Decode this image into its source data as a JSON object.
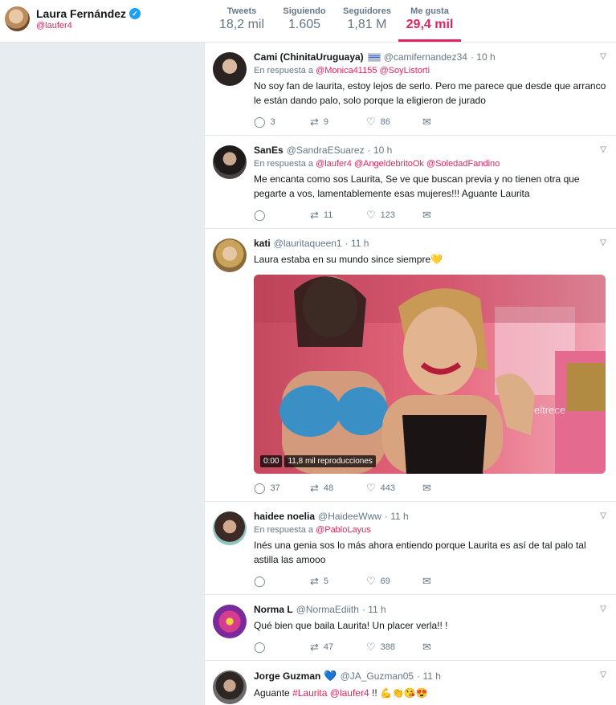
{
  "profile": {
    "name": "Laura Fernández",
    "handle": "@laufer4"
  },
  "stats": [
    {
      "label": "Tweets",
      "value": "18,2 mil"
    },
    {
      "label": "Siguiendo",
      "value": "1.605"
    },
    {
      "label": "Seguidores",
      "value": "1,81 M"
    },
    {
      "label": "Me gusta",
      "value": "29,4 mil"
    }
  ],
  "colors": {
    "accent": "#e0245e",
    "verified": "#1da1f2"
  },
  "reply_prefix": "En respuesta a",
  "tweets": [
    {
      "name": "Cami (ChinitaUruguaya)",
      "handle": "@camifernandez34",
      "time": "· 10 h",
      "reply_to": [
        "@Monica41155",
        "@SoyListorti"
      ],
      "text": "No soy fan de laurita, estoy lejos de serlo. Pero me parece que desde que arranco le están dando palo, solo porque la eligieron de jurado",
      "replies": "3",
      "retweets": "9",
      "likes": "86"
    },
    {
      "name": "SanEs",
      "handle": "@SandraESuarez",
      "time": "· 10 h",
      "reply_to": [
        "@laufer4",
        "@AngeldebritoOk",
        "@SoledadFandino"
      ],
      "text": "Me encanta como sos Laurita, Se ve que buscan previa y no tienen otra que pegarte a vos, lamentablemente esas mujeres!!! Aguante Laurita",
      "replies": "",
      "retweets": "11",
      "likes": "123"
    },
    {
      "name": "kati",
      "handle": "@lauritaqueen1",
      "time": "· 11 h",
      "text": "Laura estaba en su mundo since siempre💛",
      "video_time": "0:00",
      "video_views": "11,8 mil reproducciones",
      "watermark": "eltrece",
      "replies": "37",
      "retweets": "48",
      "likes": "443"
    },
    {
      "name": "haidee noelia",
      "handle": "@HaideeWww",
      "time": "· 11 h",
      "reply_to": [
        "@PabloLayus"
      ],
      "text": "Inés una genia sos lo más ahora entiendo porque Laurita es así de tal palo tal astilla las amooo",
      "replies": "",
      "retweets": "5",
      "likes": "69"
    },
    {
      "name": "Norma L",
      "handle": "@NormaEdiith",
      "time": "· 11 h",
      "text": "Qué bien que baila Laurita! Un placer verla!! !",
      "replies": "",
      "retweets": "47",
      "likes": "388"
    },
    {
      "name": "Jorge Guzman",
      "handle": "@JA_Guzman05",
      "time": "· 11 h",
      "text_prefix": "Aguante",
      "mentions": [
        "#Laurita",
        "@laufer4"
      ],
      "text_suffix": "!! 💪👏😘😍"
    }
  ]
}
